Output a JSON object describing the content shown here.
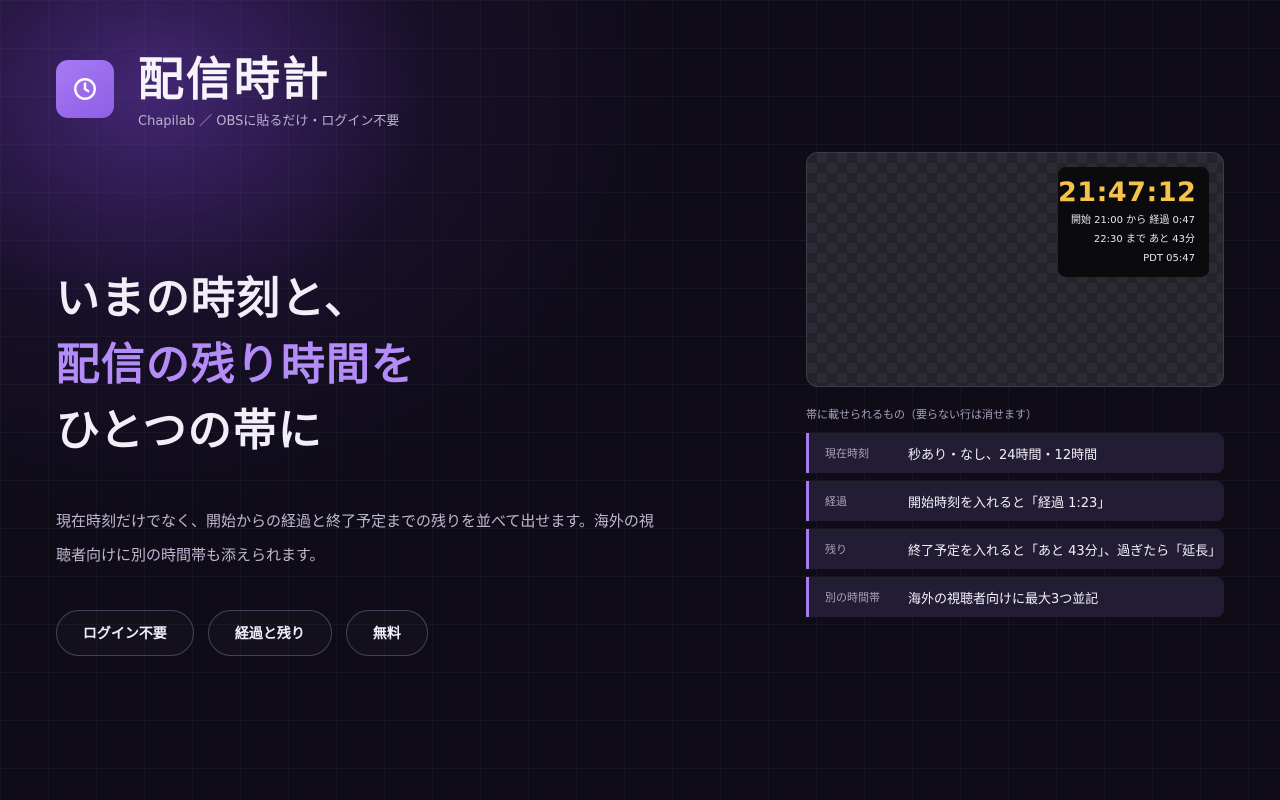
{
  "brand": {
    "title": "配信時計",
    "subtitle": "Chapilab ／ OBSに貼るだけ・ログイン不要",
    "icon": "clock-icon",
    "accent_color": "#9b6cf0"
  },
  "hero": {
    "headline_line1": "いまの時刻と、",
    "headline_line2": "配信の残り時間を",
    "headline_line3": "ひとつの帯に",
    "accent_color": "#b48cf7",
    "description": "現在時刻だけでなく、開始からの経過と終了予定までの残りを並べて出せます。海外の視聴者向けに別の時間帯も添えられます。"
  },
  "badges": [
    {
      "label": "ログイン不要"
    },
    {
      "label": "経過と残り"
    },
    {
      "label": "無料"
    }
  ],
  "preview": {
    "time": "21:47:12",
    "time_color": "#f7c24a",
    "line1": "開始 21:00 から 経過 0:47",
    "line2": "22:30 まで あと 43分",
    "line3": "PDT 05:47"
  },
  "features": {
    "caption": "帯に載せられるもの（要らない行は消せます）",
    "rows": [
      {
        "label": "現在時刻",
        "value": "秒あり・なし、24時間・12時間"
      },
      {
        "label": "経過",
        "value": "開始時刻を入れると「経過 1:23」"
      },
      {
        "label": "残り",
        "value": "終了予定を入れると「あと 43分」、過ぎたら「延長」"
      },
      {
        "label": "別の時間帯",
        "value": "海外の視聴者向けに最大3つ並記"
      }
    ]
  }
}
